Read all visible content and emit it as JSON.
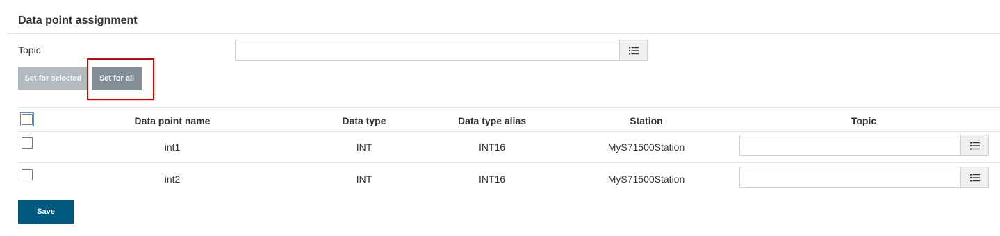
{
  "section": {
    "title": "Data point assignment"
  },
  "topic": {
    "label": "Topic",
    "value": "",
    "placeholder": "",
    "list_icon": "list-icon"
  },
  "actions": {
    "set_for_selected_label": "Set for selected",
    "set_for_all_label": "Set for all"
  },
  "table": {
    "columns": [
      "Data point name",
      "Data type",
      "Data type alias",
      "Station",
      "Topic"
    ],
    "rows": [
      {
        "name": "int1",
        "data_type": "INT",
        "alias": "INT16",
        "station": "MyS71500Station",
        "topic": "",
        "checked": false
      },
      {
        "name": "int2",
        "data_type": "INT",
        "alias": "INT16",
        "station": "MyS71500Station",
        "topic": "",
        "checked": false
      }
    ]
  },
  "footer": {
    "save_label": "Save"
  },
  "colors": {
    "primary": "#00597f",
    "button_disabled": "#b3bac0",
    "button_secondary": "#838d96",
    "highlight": "#d40000"
  }
}
